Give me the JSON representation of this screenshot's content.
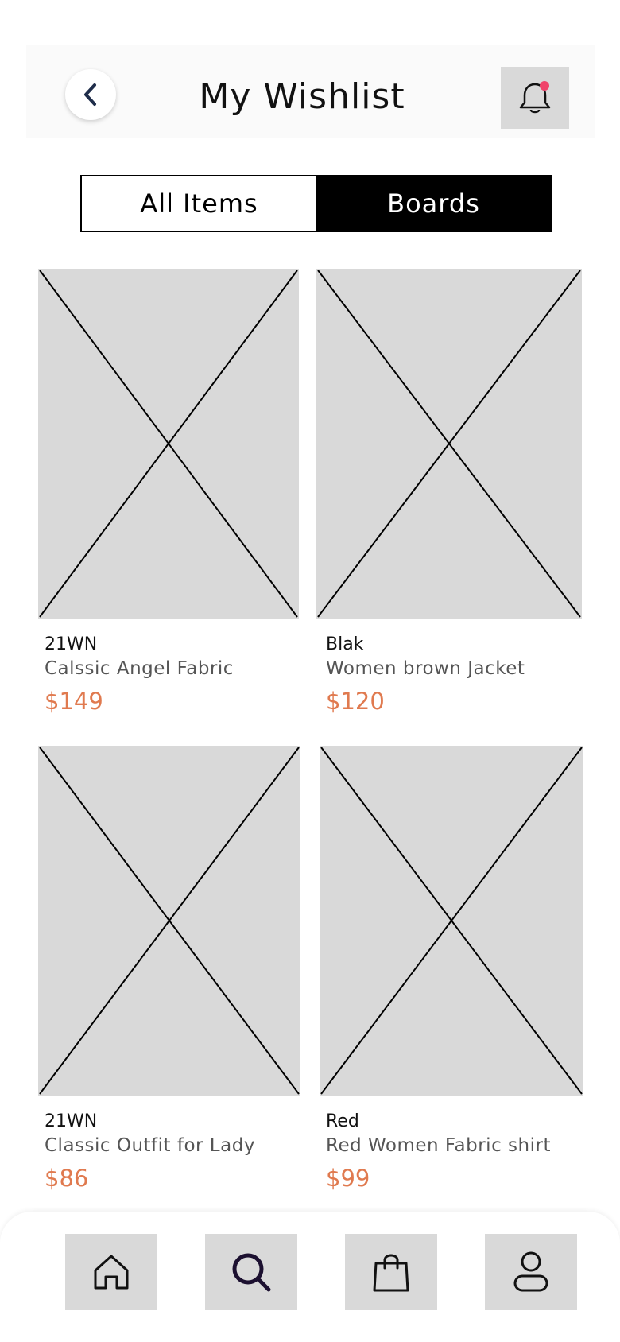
{
  "header": {
    "title": "My Wishlist"
  },
  "icons": {
    "back": "chevron-left-icon",
    "bell": "bell-icon",
    "notification_dot_color": "#f0446b"
  },
  "tabs": [
    {
      "label": "All Items",
      "active": false
    },
    {
      "label": "Boards",
      "active": true
    }
  ],
  "products": [
    {
      "brand": "21WN",
      "name": "Calssic Angel Fabric",
      "price": "$149"
    },
    {
      "brand": "Blak",
      "name": "Women brown Jacket",
      "price": "$120"
    },
    {
      "brand": "21WN",
      "name": "Classic Outfit for Lady",
      "price": "$86"
    },
    {
      "brand": "Red",
      "name": "Red Women Fabric shirt",
      "price": "$99"
    }
  ],
  "bottom_nav": [
    {
      "icon": "home-icon"
    },
    {
      "icon": "search-icon"
    },
    {
      "icon": "shopping-bag-icon"
    },
    {
      "icon": "profile-icon"
    }
  ],
  "colors": {
    "price": "#e07a4f",
    "placeholder": "#d9d9d9",
    "active_tab": "#000000"
  }
}
